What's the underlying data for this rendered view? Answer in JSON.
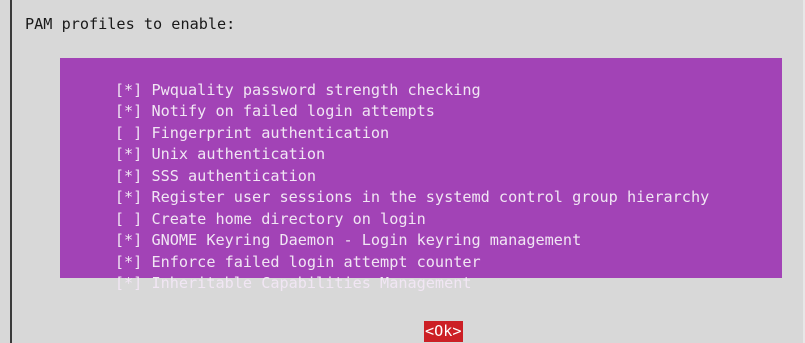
{
  "dialog": {
    "prompt": "PAM profiles to enable:",
    "items": [
      {
        "mark": "[*]",
        "label": "Pwquality password strength checking"
      },
      {
        "mark": "[*]",
        "label": "Notify on failed login attempts"
      },
      {
        "mark": "[ ]",
        "label": "Fingerprint authentication"
      },
      {
        "mark": "[*]",
        "label": "Unix authentication"
      },
      {
        "mark": "[*]",
        "label": "SSS authentication"
      },
      {
        "mark": "[*]",
        "label": "Register user sessions in the systemd control group hierarchy"
      },
      {
        "mark": "[ ]",
        "label": "Create home directory on login"
      },
      {
        "mark": "[*]",
        "label": "GNOME Keyring Daemon - Login keyring management"
      },
      {
        "mark": "[*]",
        "label": "Enforce failed login attempt counter"
      },
      {
        "mark": "[*]",
        "label": "Inheritable Capabilities Management"
      }
    ],
    "ok_label": "<Ok>"
  },
  "colors": {
    "dialog_background": "#d8d8d8",
    "list_highlight": "#a243b6",
    "ok_button": "#cc1f25"
  }
}
